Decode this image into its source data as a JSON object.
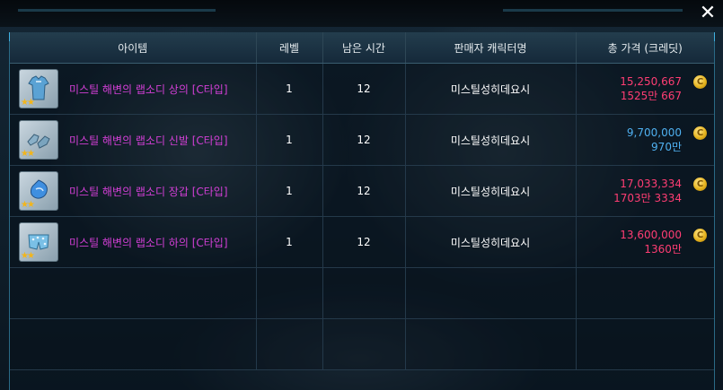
{
  "header": {
    "close_label": "✕"
  },
  "columns": {
    "item": "아이템",
    "level": "레벨",
    "time_left": "남은 시간",
    "seller": "판매자 캐릭터명",
    "total_price": "총 가격 (크레딧)"
  },
  "rows": [
    {
      "name": "미스틸 해변의 랩소디 상의 [C타입]",
      "level": "1",
      "time_left": "12",
      "seller": "미스틸성히데요시",
      "price_main": "15,250,667",
      "price_sub": "1525만 667",
      "price_color": "#ff3d73",
      "icon": "top-clothing-icon",
      "stars": "★★"
    },
    {
      "name": "미스틸 해변의 랩소디 신발 [C타입]",
      "level": "1",
      "time_left": "12",
      "seller": "미스틸성히데요시",
      "price_main": "9,700,000",
      "price_sub": "970만",
      "price_color": "#4fb0f0",
      "icon": "shoes-icon",
      "stars": "★★"
    },
    {
      "name": "미스틸 해변의 랩소디 장갑 [C타입]",
      "level": "1",
      "time_left": "12",
      "seller": "미스틸성히데요시",
      "price_main": "17,033,334",
      "price_sub": "1703만 3334",
      "price_color": "#ff3d73",
      "icon": "gloves-icon",
      "stars": "★★"
    },
    {
      "name": "미스틸 해변의 랩소디 하의 [C타입]",
      "level": "1",
      "time_left": "12",
      "seller": "미스틸성히데요시",
      "price_main": "13,600,000",
      "price_sub": "1360만",
      "price_color": "#ff3d73",
      "icon": "bottom-clothing-icon",
      "stars": "★★"
    }
  ],
  "currency": {
    "icon": "credit-coin-icon",
    "symbol": "C"
  },
  "colors": {
    "item_name": "#d33fd6",
    "accent": "#3fb0e0"
  }
}
